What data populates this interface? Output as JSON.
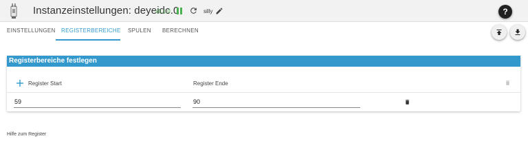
{
  "header": {
    "title": "Instanzeinstellungen: deyeidc.0",
    "version": "v0.1.0",
    "loglevel": "silly",
    "help_label": "?"
  },
  "tabs": [
    {
      "label": "Einstellungen",
      "active": false
    },
    {
      "label": "Registerbereiche",
      "active": true
    },
    {
      "label": "Spulen",
      "active": false
    },
    {
      "label": "Berechnen",
      "active": false
    }
  ],
  "panel": {
    "title": "Registerbereiche festlegen",
    "columns": [
      "Register Start",
      "Register Ende"
    ],
    "rows": [
      {
        "start": "59",
        "end": "90"
      }
    ]
  },
  "footer": {
    "help_text": "Hilfe zum Register"
  },
  "icons": {
    "logo": "deye-logo-icon",
    "pause": "pause-icon",
    "refresh": "refresh-icon",
    "edit": "pencil-icon",
    "help": "help-icon",
    "upload": "upload-icon",
    "download": "download-icon",
    "add": "plus-icon",
    "delete": "trash-icon"
  },
  "colors": {
    "accent": "#3399cc",
    "version": "#4caf50",
    "pause": "#4caf50",
    "topbar": "#f2f2f2"
  }
}
